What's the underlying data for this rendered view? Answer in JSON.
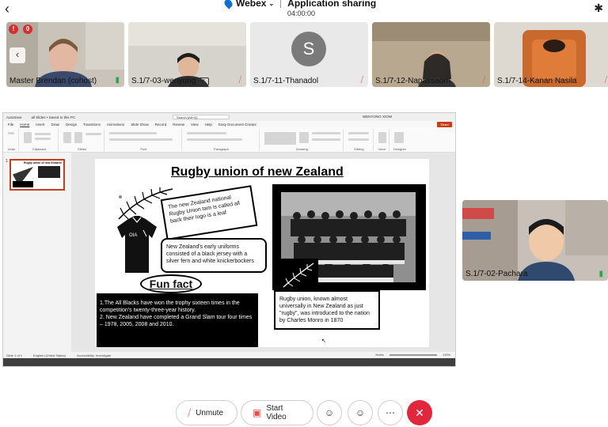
{
  "app": {
    "name": "Webex",
    "title": "Application sharing",
    "timer": "04:00:00"
  },
  "participants_strip": [
    {
      "name": "Master Brendan (cohost)",
      "mic": "on"
    },
    {
      "name": "S.1/7-03-wenyong",
      "mic": "off",
      "sharing": true
    },
    {
      "name": "S.1/7-11-Thanadol",
      "mic": "off",
      "avatar_letter": "S"
    },
    {
      "name": "S.1/7-12-Napassaorn",
      "mic": "off"
    },
    {
      "name": "S.1/7-14-Kanan Nasila",
      "mic": "off"
    }
  ],
  "right_participant": {
    "name": "S.1/7-02-Pachara",
    "mic": "on"
  },
  "powerpoint": {
    "filename": "all Slides • Saved to this PC",
    "search_placeholder": "Search (Alt+Q)",
    "user": "WENYONG XIOW",
    "share_label": "Share",
    "menu": [
      "File",
      "Home",
      "Insert",
      "Draw",
      "Design",
      "Transitions",
      "Animations",
      "Slide Show",
      "Record",
      "Review",
      "View",
      "Help",
      "Easy Document Creator"
    ],
    "ribbon_groups": [
      "Undo",
      "Clipboard",
      "Slides",
      "Font",
      "Paragraph",
      "Drawing",
      "Editing",
      "Voice",
      "Designer"
    ],
    "status_left": "Slide 1 of 1",
    "status_lang": "English (United States)",
    "status_access": "Accessibility: Investigate",
    "status_right": "Notes",
    "zoom": "115%"
  },
  "slide": {
    "title": "Rugby union of new Zealand",
    "callout_logo": "The new Zealand national Rugby Union tam is called all back their logo is a leaf",
    "callout_uniform": "New Zealand's early uniforms consisted of a black jersey with a silver fern and white knickerbockers",
    "fun_fact_heading": "Fun fact",
    "fun_fact_1": "1.The All Blacks have won the trophy sixteen times in the competition's twenty-three-year history.",
    "fun_fact_2": "2. New Zealand have completed a Grand Slam tour four times – 1978, 2005, 2008 and 2010.",
    "rugby_info": "Rugby union, known almost universally in New Zealand as just \"rugby\", was introduced to the nation by Charles Monro in 1870"
  },
  "controls": {
    "unmute": "Unmute",
    "start_video": "Start Video"
  },
  "badges": {
    "rec1": "!",
    "rec2": "0"
  }
}
